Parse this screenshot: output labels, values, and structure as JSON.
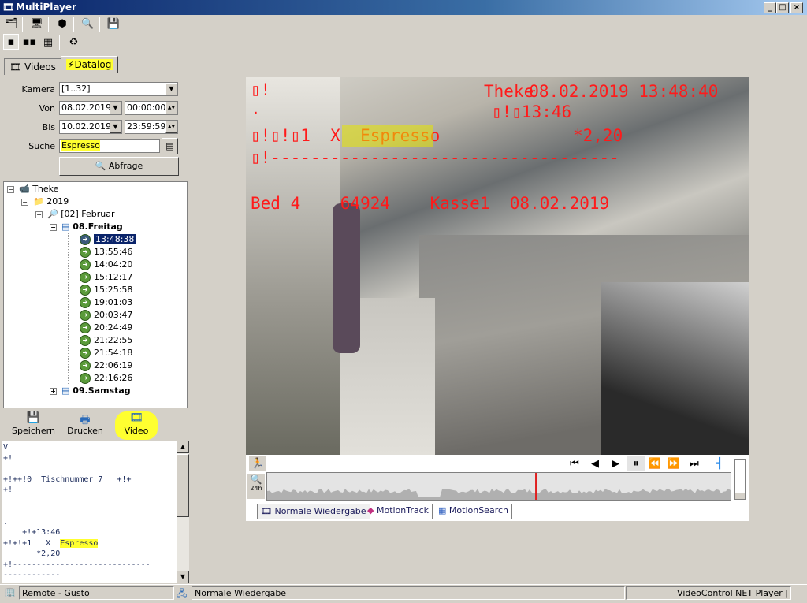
{
  "window": {
    "title": "MultiPlayer",
    "min": "_",
    "max": "□",
    "close": "×"
  },
  "tabs": [
    {
      "label": "Videos",
      "active": false
    },
    {
      "label": "Datalog",
      "active": true
    }
  ],
  "form": {
    "kamera_label": "Kamera",
    "kamera_value": "[1..32]",
    "von_label": "Von",
    "von_date": "08.02.2019",
    "von_time": "00:00:00",
    "bis_label": "Bis",
    "bis_date": "10.02.2019",
    "bis_time": "23:59:59",
    "suche_label": "Suche",
    "suche_value": "Espresso",
    "query_button": "Abfrage"
  },
  "tree": {
    "root": "Theke",
    "year": "2019",
    "month": "[02] Februar",
    "day1": "08.Freitag",
    "day2": "09.Samstag",
    "selected": "13:48:38",
    "times": [
      "13:48:38",
      "13:55:46",
      "14:04:20",
      "15:12:17",
      "15:25:58",
      "19:01:03",
      "20:03:47",
      "20:24:49",
      "21:22:55",
      "21:54:18",
      "22:06:19",
      "22:16:26"
    ]
  },
  "bottom_toolbar": {
    "save": "Speichern",
    "print": "Drucken",
    "video": "Video"
  },
  "log": {
    "lines": [
      "V",
      "+!",
      "",
      "+!++!0  Tischnummer 7   +!+",
      "+!",
      "",
      "",
      ".",
      "    +!+13:46"
    ],
    "item_prefix": "+!+!+1   X  ",
    "item": "Espresso",
    "price": "       *2,20",
    "sep1": "+!-----------------------------",
    "sep2": "------------"
  },
  "overlay": {
    "l1": "▯!",
    "l2": ".",
    "l3": "▯!▯!▯1  X  Espresso",
    "l4": "▯!-----------------------------------",
    "cam": "Theke",
    "timestamp": "08.02.2019 13:48:40",
    "time": "▯!▯13:46",
    "price": "*2,20",
    "footer": "Bed 4    64924    Kasse1  08.02.2019"
  },
  "player": {
    "tabs": [
      "Normale Wiedergabe",
      "MotionTrack",
      "MotionSearch"
    ],
    "range_label": "24h",
    "position_fraction": 0.58
  },
  "status": {
    "connection": "Remote - Gusto",
    "mode": "Normale Wiedergabe",
    "app": "VideoControl NET Player |"
  },
  "colors": {
    "highlight": "#ffff30",
    "overlay_text": "#ff1a1a",
    "selection": "#0a246a",
    "playhead": "#e02020"
  }
}
